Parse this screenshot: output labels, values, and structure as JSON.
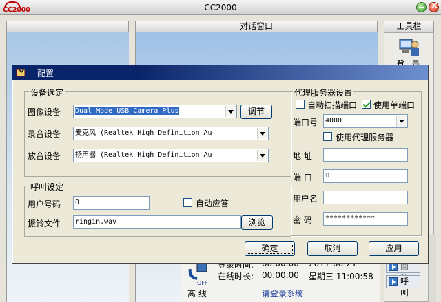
{
  "app": {
    "title": "CC2000",
    "logo_text": "CC2000",
    "panels": {
      "left": "",
      "chat": "对话窗口",
      "toolbar": "工具栏"
    },
    "toolbar": {
      "login_label": "登 录"
    },
    "status": {
      "login_time_label": "登录时间:",
      "login_time": "00:00:00",
      "login_date": "2011-06-21",
      "online_label": "在线时长:",
      "online_time": "00:00:00",
      "online_day_time": "星期三 11:00:58",
      "bottom_left": "离 线",
      "bottom_right": "请登录系统"
    },
    "side_buttons": {
      "play": "回放",
      "call": "呼叫"
    }
  },
  "dialog": {
    "title": "配置",
    "device_group": {
      "title": "设备选定",
      "image_device_label": "图像设备",
      "image_device_value": "Dual Mode USB Camera Plus",
      "adjust_button": "调节",
      "record_device_label": "录音设备",
      "record_device_value": "麦克风 (Realtek High Definition Au",
      "play_device_label": "放音设备",
      "play_device_value": "扬声器 (Realtek High Definition Au"
    },
    "call_group": {
      "title": "呼叫设定",
      "user_number_label": "用户号码",
      "user_number_value": "0",
      "auto_answer_label": "自动应答",
      "auto_answer_checked": false,
      "ring_file_label": "振铃文件",
      "ring_file_value": "ringin.wav",
      "browse_button": "浏览"
    },
    "proxy_group": {
      "title": "代理服务器设置",
      "auto_scan_label": "自动扫描端口",
      "auto_scan_checked": false,
      "single_port_label": "使用单端口",
      "single_port_checked": true,
      "port_label": "端口号",
      "port_value": "4000",
      "use_proxy_label": "使用代理服务器",
      "use_proxy_checked": false,
      "address_label": "地 址",
      "address_value": "",
      "proxy_port_label": "端 口",
      "proxy_port_value": "0",
      "username_label": "用户名",
      "username_value": "",
      "password_label": "密 码",
      "password_value": "************"
    },
    "buttons": {
      "ok": "确定",
      "cancel": "取消",
      "apply": "应用"
    }
  }
}
